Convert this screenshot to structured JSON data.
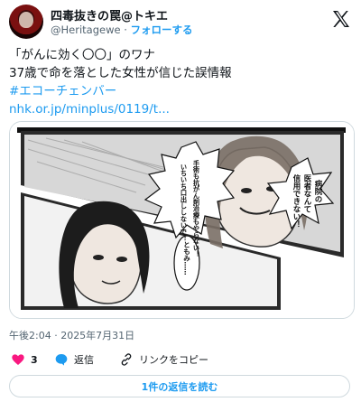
{
  "author": {
    "display_name": "四毒抜きの罠@トキエ",
    "handle": "@Heritagewe",
    "separator": "·",
    "follow_label": "フォローする"
  },
  "post": {
    "line1": "「がんに効く〇〇」のワナ",
    "line2": "37歳で命を落とした女性が信じた誤情報",
    "hashtag": "#エコーチェンバー",
    "link": "nhk.or.jp/minplus/0119/t..."
  },
  "manga": {
    "bubble_doctor": [
      "病院の",
      "医者なんて",
      "信用できない！"
    ],
    "bubble_treatment": [
      "手術も抗がん剤治療もやらない！",
      "いちいち口出ししないで！"
    ],
    "bubble_tomomi": "ともみ……"
  },
  "meta": {
    "timestamp": "午後2:04 · 2025年7月31日"
  },
  "actions": {
    "like_count": "3",
    "reply_label": "返信",
    "copy_link_label": "リンクをコピー"
  },
  "read_replies_label": "1件の返信を読む",
  "colors": {
    "accent": "#1d9bf0",
    "like": "#f91880",
    "muted": "#536471"
  },
  "icons": [
    "x-logo-icon",
    "heart-icon",
    "reply-icon",
    "link-icon"
  ]
}
